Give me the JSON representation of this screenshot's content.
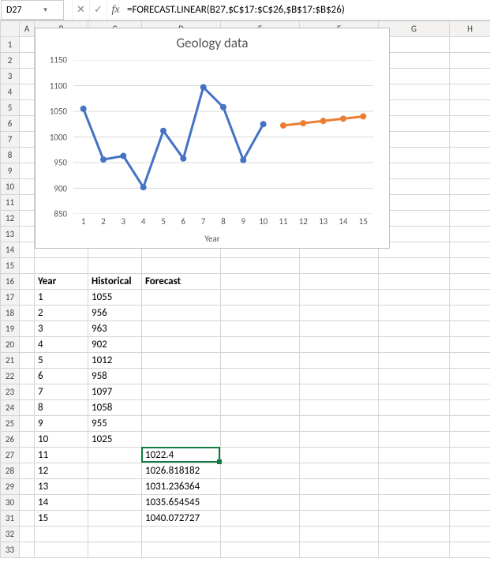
{
  "nameBox": "D27",
  "formula": "=FORECAST.LINEAR(B27,$C$17:$C$26,$B$17:$B$26)",
  "columns": [
    "A",
    "B",
    "C",
    "D",
    "E",
    "F",
    "G",
    "H"
  ],
  "headers": {
    "year": "Year",
    "hist": "Historical",
    "fcst": "Forecast"
  },
  "rows": [
    {
      "r": 17,
      "year": "1",
      "hist": "1055",
      "fcst": ""
    },
    {
      "r": 18,
      "year": "2",
      "hist": "956",
      "fcst": ""
    },
    {
      "r": 19,
      "year": "3",
      "hist": "963",
      "fcst": ""
    },
    {
      "r": 20,
      "year": "4",
      "hist": "902",
      "fcst": ""
    },
    {
      "r": 21,
      "year": "5",
      "hist": "1012",
      "fcst": ""
    },
    {
      "r": 22,
      "year": "6",
      "hist": "958",
      "fcst": ""
    },
    {
      "r": 23,
      "year": "7",
      "hist": "1097",
      "fcst": ""
    },
    {
      "r": 24,
      "year": "8",
      "hist": "1058",
      "fcst": ""
    },
    {
      "r": 25,
      "year": "9",
      "hist": "955",
      "fcst": ""
    },
    {
      "r": 26,
      "year": "10",
      "hist": "1025",
      "fcst": ""
    },
    {
      "r": 27,
      "year": "11",
      "hist": "",
      "fcst": "1022.4"
    },
    {
      "r": 28,
      "year": "12",
      "hist": "",
      "fcst": "1026.818182"
    },
    {
      "r": 29,
      "year": "13",
      "hist": "",
      "fcst": "1031.236364"
    },
    {
      "r": 30,
      "year": "14",
      "hist": "",
      "fcst": "1035.654545"
    },
    {
      "r": 31,
      "year": "15",
      "hist": "",
      "fcst": "1040.072727"
    }
  ],
  "chart_data": {
    "type": "line",
    "title": "Geology data",
    "xlabel": "Year",
    "ylabel": "",
    "ylim": [
      850,
      1150
    ],
    "yticks": [
      850,
      900,
      950,
      1000,
      1050,
      1100,
      1150
    ],
    "x": [
      1,
      2,
      3,
      4,
      5,
      6,
      7,
      8,
      9,
      10,
      11,
      12,
      13,
      14,
      15
    ],
    "series": [
      {
        "name": "Historical",
        "color": "#4472c4",
        "x": [
          1,
          2,
          3,
          4,
          5,
          6,
          7,
          8,
          9,
          10
        ],
        "values": [
          1055,
          956,
          963,
          902,
          1012,
          958,
          1097,
          1058,
          955,
          1025
        ]
      },
      {
        "name": "Forecast",
        "color": "#ed7d31",
        "x": [
          11,
          12,
          13,
          14,
          15
        ],
        "values": [
          1022.4,
          1026.818182,
          1031.236364,
          1035.654545,
          1040.072727
        ]
      }
    ]
  }
}
